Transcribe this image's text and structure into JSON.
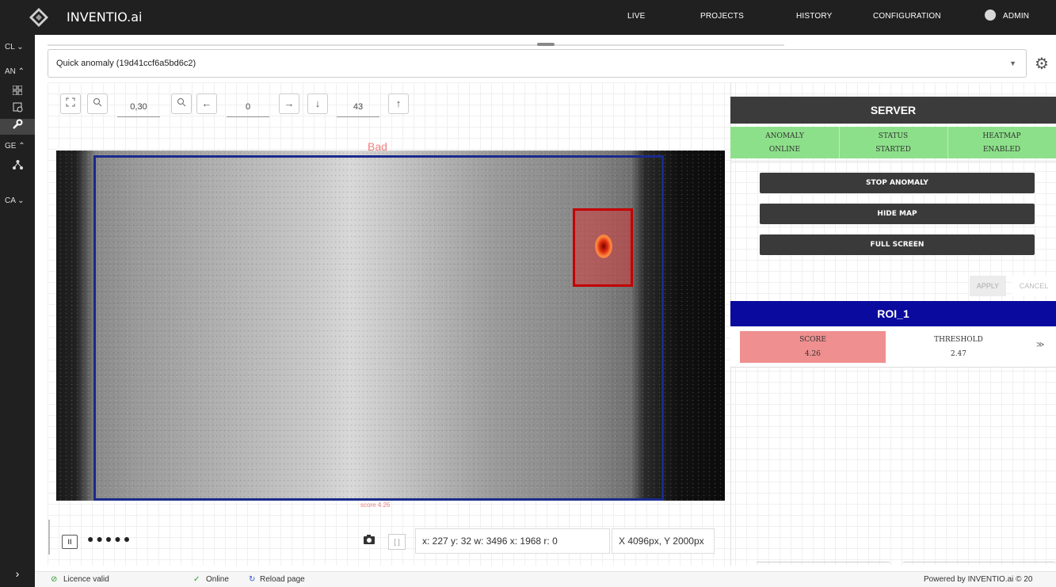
{
  "topbar": {
    "brand": "INVENTIO.ai",
    "nav": [
      "LIVE",
      "PROJECTS",
      "HISTORY",
      "CONFIGURATION",
      "ADMIN"
    ]
  },
  "sidebar": {
    "items": [
      {
        "label": "CL ⌄"
      },
      {
        "label": "AN ⌃"
      },
      {
        "label": "GE ⌃"
      },
      {
        "label": "CA ⌄"
      }
    ],
    "icons": [
      "grid-icon",
      "image-settings-icon",
      "wrench-icon",
      "network-icon"
    ],
    "collapse": "›"
  },
  "toolbar": {
    "select_value": "Quick anomaly (19d41ccf6a5bd6c2)",
    "zoom": "0,30",
    "x": "0",
    "y": "43"
  },
  "viewer": {
    "label": "Bad",
    "score_caption": "score 4.26",
    "coords": "x: 227 y: 32 w: 3496 x: 1968 r: 0",
    "image_size": "X 4096px, Y 2000px"
  },
  "server": {
    "title": "SERVER",
    "status": [
      {
        "label": "ANOMALY",
        "value": "ONLINE"
      },
      {
        "label": "STATUS",
        "value": "STARTED"
      },
      {
        "label": "HEATMAP",
        "value": "ENABLED"
      }
    ],
    "buttons": [
      "STOP ANOMALY",
      "HIDE MAP",
      "FULL SCREEN"
    ],
    "apply": "APPLY",
    "cancel": "CANCEL",
    "colors": {
      "status_bg": "#8de08a",
      "roi_bg": "#0a0a9e",
      "score_bg": "#ef8f8f"
    }
  },
  "roi": {
    "title": "ROI_1",
    "score_label": "SCORE",
    "score": "4.26",
    "threshold_label": "THRESHOLD",
    "threshold": "2.47"
  },
  "statusbar": {
    "licence": "Licence valid",
    "online": "Online",
    "reload": "Reload page",
    "powered": "Powered by  INVENTIO.ai  © 20"
  }
}
